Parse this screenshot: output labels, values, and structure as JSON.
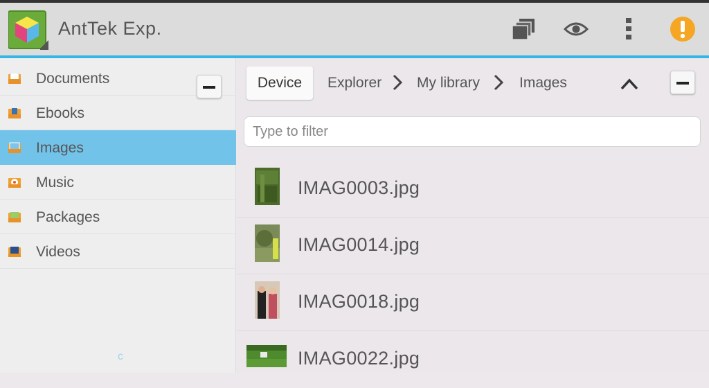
{
  "app": {
    "title": "AntTek Exp.",
    "icons": [
      "app-cube-logo",
      "copy-icon",
      "eye-icon",
      "overflow-menu-icon",
      "warning-icon"
    ],
    "colors": {
      "accent": "#33b5e5",
      "selection": "#72c3ea",
      "warning": "#f5a623"
    }
  },
  "sidebar": {
    "items": [
      {
        "label": "Documents",
        "icon": "documents-icon",
        "selected": false
      },
      {
        "label": "Ebooks",
        "icon": "ebooks-icon",
        "selected": false
      },
      {
        "label": "Images",
        "icon": "images-icon",
        "selected": true
      },
      {
        "label": "Music",
        "icon": "music-icon",
        "selected": false
      },
      {
        "label": "Packages",
        "icon": "packages-icon",
        "selected": false
      },
      {
        "label": "Videos",
        "icon": "videos-icon",
        "selected": false
      }
    ],
    "footer_glyph": "c"
  },
  "breadcrumb": {
    "items": [
      "Device",
      "Explorer",
      "My library",
      "Images"
    ]
  },
  "filter": {
    "placeholder": "Type to filter",
    "value": ""
  },
  "files": [
    {
      "name": "IMAG0003.jpg"
    },
    {
      "name": "IMAG0014.jpg"
    },
    {
      "name": "IMAG0018.jpg"
    },
    {
      "name": "IMAG0022.jpg"
    }
  ]
}
